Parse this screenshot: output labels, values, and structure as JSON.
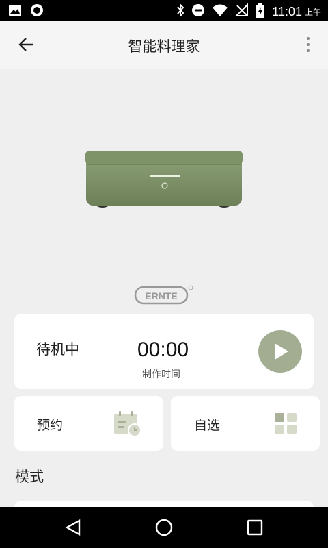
{
  "status_bar": {
    "time": "11:01",
    "ampm": "上午",
    "icons": [
      "image-icon",
      "circle-app-icon",
      "bluetooth-icon",
      "do-not-disturb-icon",
      "wifi-icon",
      "no-signal-icon",
      "battery-charging-icon"
    ]
  },
  "app_bar": {
    "title": "智能料理家",
    "back_icon": "arrow-left-icon",
    "menu_icon": "more-vertical-icon"
  },
  "device_status": {
    "state": "待机中",
    "time_value": "00:00",
    "time_label": "制作时间",
    "play_icon": "play-icon"
  },
  "actions": [
    {
      "label": "预约",
      "icon": "calendar-clock-icon"
    },
    {
      "label": "自选",
      "icon": "grid-icon"
    }
  ],
  "section": {
    "title": "模式"
  },
  "colors": {
    "accent": "#a2ad91",
    "icon_light": "#d5dbc8",
    "icon_dark": "#a9b199",
    "product_green": "#7e9367"
  },
  "nav_bar": {
    "icons": [
      "back-triangle-icon",
      "home-circle-icon",
      "recents-square-icon"
    ]
  }
}
